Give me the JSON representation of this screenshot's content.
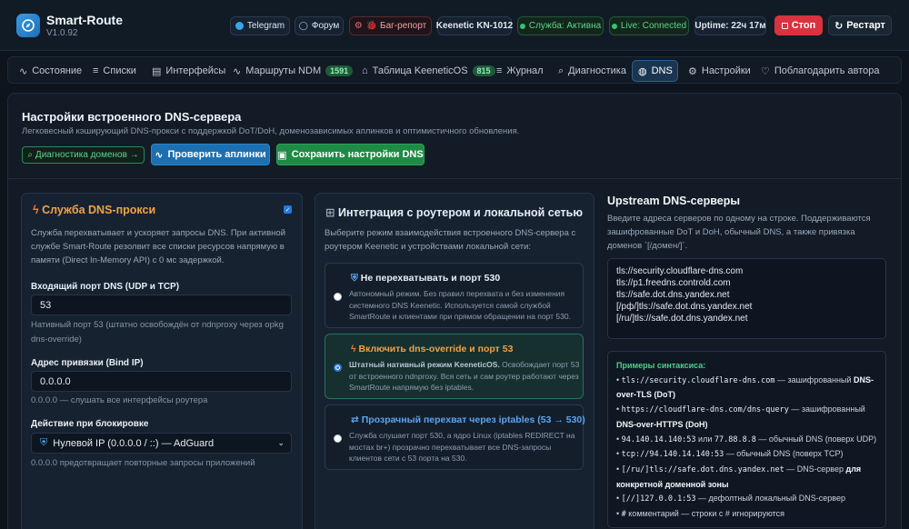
{
  "app": {
    "title": "Smart-Route",
    "version": "V1.0.92"
  },
  "header": {
    "telegram": "Telegram",
    "forum": "Форум",
    "bug": "🐞 Баг-репорт",
    "router": "Keenetic KN-1012",
    "service": "Служба: Активна",
    "live": "Live: Connected",
    "uptime": "Uptime: 22ч 17м",
    "stop": "Стоп",
    "restart": "Рестарт"
  },
  "tabs": [
    {
      "label": "Состояние"
    },
    {
      "label": "Списки"
    },
    {
      "label": "Интерфейсы"
    },
    {
      "label": "Маршруты NDM",
      "badge": "1591"
    },
    {
      "label": "Таблица KeeneticOS",
      "badge": "815"
    },
    {
      "label": "Журнал"
    },
    {
      "label": "Диагностика"
    },
    {
      "label": "DNS"
    },
    {
      "label": "Настройки"
    },
    {
      "label": "Поблагодарить автора"
    }
  ],
  "dns": {
    "title": "Настройки встроенного DNS-сервера",
    "subtitle": "Легковесный кэширующий DNS-прокси с поддержкой DoT/DoH, доменозависимых аплинков и оптимистичного обновления.",
    "diag_button": "Диагностика доменов →",
    "check_button": "Проверить аплинки",
    "save_button": "Сохранить настройки DNS"
  },
  "proxy": {
    "title": "Служба DNS-прокси",
    "description": "Служба перехватывает и ускоряет запросы DNS. При активной службе Smart-Route резолвит все списки ресурсов напрямую в памяти (Direct In-Memory API) с 0 мс задержкой.",
    "enabled": true,
    "port_label": "Входящий порт DNS (UDP и TCP)",
    "port_value": "53",
    "port_hint": "Нативный порт 53 (штатно освобождён от ndnproxy через opkg dns-override)",
    "bind_label": "Адрес привязки (Bind IP)",
    "bind_value": "0.0.0.0",
    "bind_hint": "0.0.0.0 — слушать все интерфейсы роутера",
    "block_label": "Действие при блокировке",
    "block_value": "Нулевой IP (0.0.0.0 / ::) — AdGuard",
    "block_hint": "0.0.0.0 предотвращает повторные запросы приложений"
  },
  "integration": {
    "title": "Интеграция с роутером и локальной сетью",
    "description": "Выберите режим взаимодействия встроенного DNS-сервера с роутером Keenetic и устройствами локальной сети:",
    "options": [
      {
        "title": "Не перехватывать и порт 530",
        "text": "Автономный режим. Без правил перехвата и без изменения системного DNS Keenetic. Используется самой службой SmartRoute и клиентами при прямом обращении на порт 530.",
        "selected": false
      },
      {
        "title": "Включить dns-override и порт 53",
        "text_bold": "Штатный нативный режим KeeneticOS.",
        "text": " Освобождает порт 53 от встроенного ndnproxy. Вся сеть и сам роутер работают через SmartRoute напрямую без iptables.",
        "selected": true
      },
      {
        "title": "Прозрачный перехват через iptables (53 → 530)",
        "text": "Служба слушает порт 530, а ядро Linux (iptables REDIRECT на мостах br+) прозрачно перехватывает все DNS-запросы клиентов сети с 53 порта на 530.",
        "selected": false
      }
    ]
  },
  "upstream": {
    "title": "Upstream DNS-серверы",
    "description": "Введите адреса серверов по одному на строке. Поддерживаются зашифрованные DoT и DoH, обычный DNS, а также привязка доменов `[/домен/]`.",
    "servers": [
      "tls://security.cloudflare-dns.com",
      "tls://p1.freedns.controld.com",
      "tls://safe.dot.dns.yandex.net",
      "[/рф/]tls://safe.dot.dns.yandex.net",
      "[/ru/]tls://safe.dot.dns.yandex.net"
    ],
    "examples_title": "Примеры синтаксиса:",
    "ex1_code": "tls://security.cloudflare-dns.com",
    "ex1_text": " — зашифрованный ",
    "ex1_bold": "DNS-over-TLS (DoT)",
    "ex2_code": "https://cloudflare-dns.com/dns-query",
    "ex2_text": " — зашифрованный ",
    "ex2_bold": "DNS-over-HTTPS (DoH)",
    "ex3_code1": "94.140.14.140:53",
    "ex3_mid": " или ",
    "ex3_code2": "77.88.8.8",
    "ex3_text": " — обычный DNS (поверх UDP)",
    "ex4_code": "tcp://94.140.14.140:53",
    "ex4_text": " — обычный DNS (поверх TCP)",
    "ex5_code": "[/ru/]tls://safe.dot.dns.yandex.net",
    "ex5_text": " — DNS-сервер ",
    "ex5_bold": "для конкретной доменной зоны",
    "ex6_code": "[//]127.0.0.1:53",
    "ex6_text": " — дефолтный локальный DNS-сервер",
    "ex7_code": "#",
    "ex7_text": "  комментарий — строки с # игнорируются"
  }
}
